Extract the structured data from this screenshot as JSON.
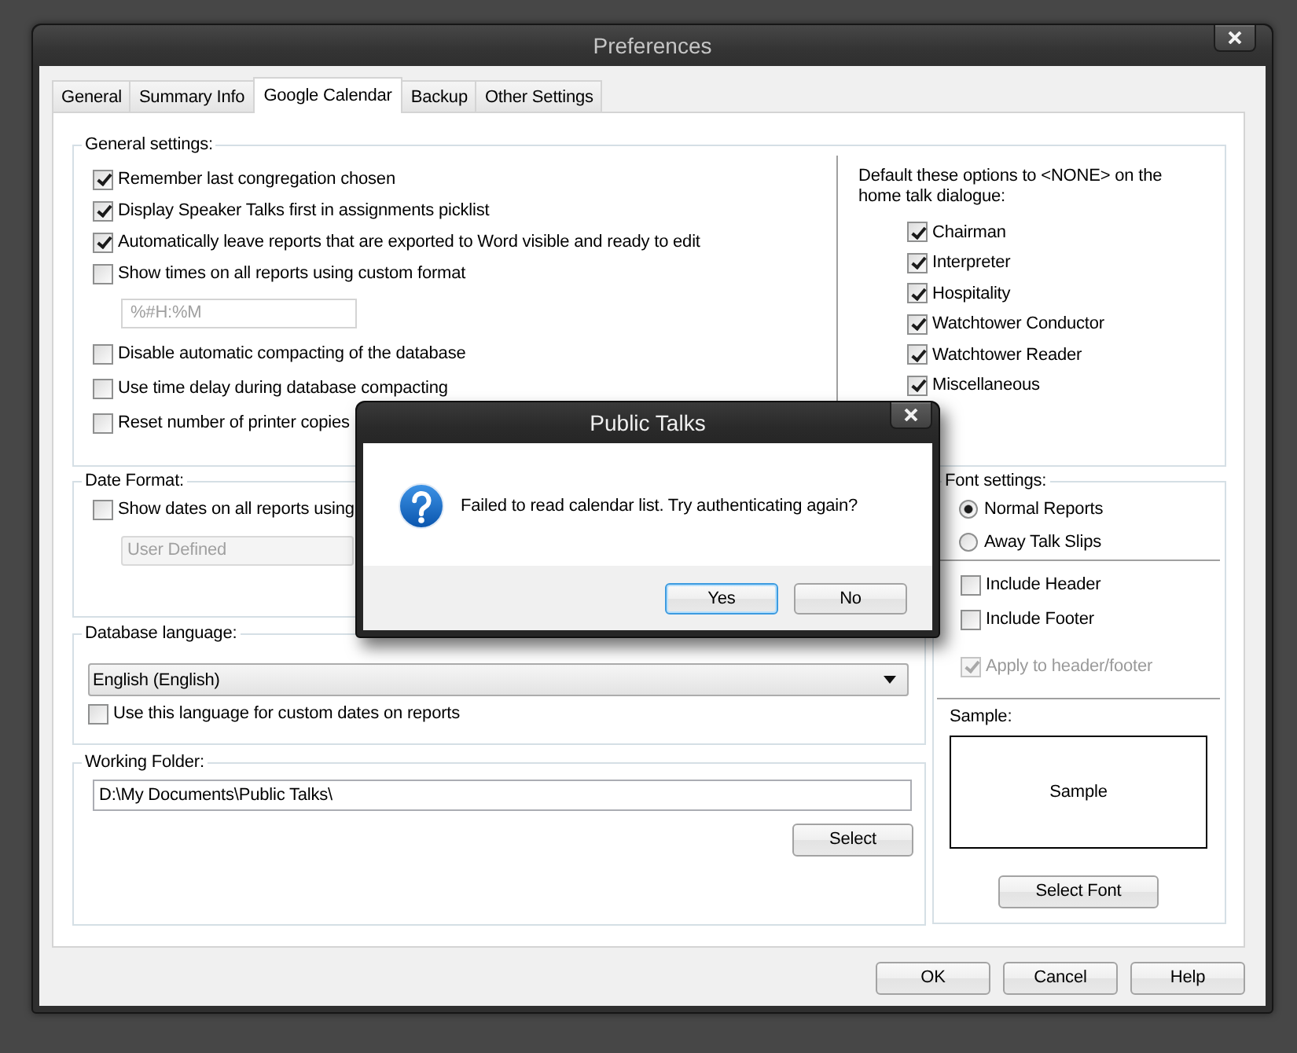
{
  "window": {
    "title": "Preferences"
  },
  "tabs": [
    {
      "label": "General",
      "selected": false
    },
    {
      "label": "Summary Info",
      "selected": false
    },
    {
      "label": "Google Calendar",
      "selected": true
    },
    {
      "label": "Backup",
      "selected": false
    },
    {
      "label": "Other Settings",
      "selected": false
    }
  ],
  "general_settings": {
    "title": "General settings:",
    "options": [
      {
        "kind": "checkbox",
        "label": "Remember last congregation chosen",
        "checked": true
      },
      {
        "kind": "checkbox",
        "label": "Display Speaker Talks first in assignments picklist",
        "checked": true
      },
      {
        "kind": "checkbox",
        "label": "Automatically leave reports that are exported to Word visible and ready to edit",
        "checked": true
      },
      {
        "kind": "checkbox",
        "label": "Show times on all reports using custom format",
        "checked": false
      },
      {
        "kind": "field",
        "value": "%#H:%M",
        "disabled": true
      },
      {
        "kind": "checkbox",
        "label": "Disable automatic compacting of the database",
        "checked": false
      },
      {
        "kind": "checkbox",
        "label": "Use time delay during database compacting",
        "checked": false
      },
      {
        "kind": "checkbox",
        "label": "Reset number of printer copies",
        "checked": false
      }
    ],
    "defaults": {
      "caption": "Default these options to <NONE> on the home talk dialogue:",
      "options": [
        {
          "label": "Chairman",
          "checked": true
        },
        {
          "label": "Interpreter",
          "checked": true
        },
        {
          "label": "Hospitality",
          "checked": true
        },
        {
          "label": "Watchtower Conductor",
          "checked": true
        },
        {
          "label": "Watchtower Reader",
          "checked": true
        },
        {
          "label": "Miscellaneous",
          "checked": true
        }
      ]
    }
  },
  "date_format": {
    "title": "Date Format:",
    "checkbox": {
      "label": "Show dates on all reports using",
      "checked": false
    },
    "dropdown": {
      "value": "User Defined",
      "disabled": true
    }
  },
  "database_language": {
    "title": "Database language:",
    "dropdown": {
      "value": "English (English)"
    },
    "checkbox": {
      "label": "Use this language for custom dates on reports",
      "checked": false
    }
  },
  "working_folder": {
    "title": "Working Folder:",
    "value": "D:\\My Documents\\Public Talks\\",
    "button": "Select"
  },
  "font_settings": {
    "title": "Font settings:",
    "report_types": [
      {
        "label": "Normal Reports",
        "selected": true
      },
      {
        "label": "Away Talk Slips",
        "selected": false
      }
    ],
    "options": [
      {
        "label": "Include Header",
        "checked": false,
        "disabled": false
      },
      {
        "label": "Include Footer",
        "checked": false,
        "disabled": false
      },
      {
        "label": "Apply to header/footer",
        "checked": true,
        "disabled": true
      }
    ],
    "sample_label": "Sample:",
    "sample_text": "Sample",
    "button": "Select Font"
  },
  "buttons": [
    "OK",
    "Cancel",
    "Help"
  ],
  "dialog": {
    "title": "Public Talks",
    "message": "Failed to read calendar list. Try authenticating again?",
    "buttons": [
      {
        "label": "Yes",
        "focused": true
      },
      {
        "label": "No",
        "focused": false
      }
    ]
  }
}
